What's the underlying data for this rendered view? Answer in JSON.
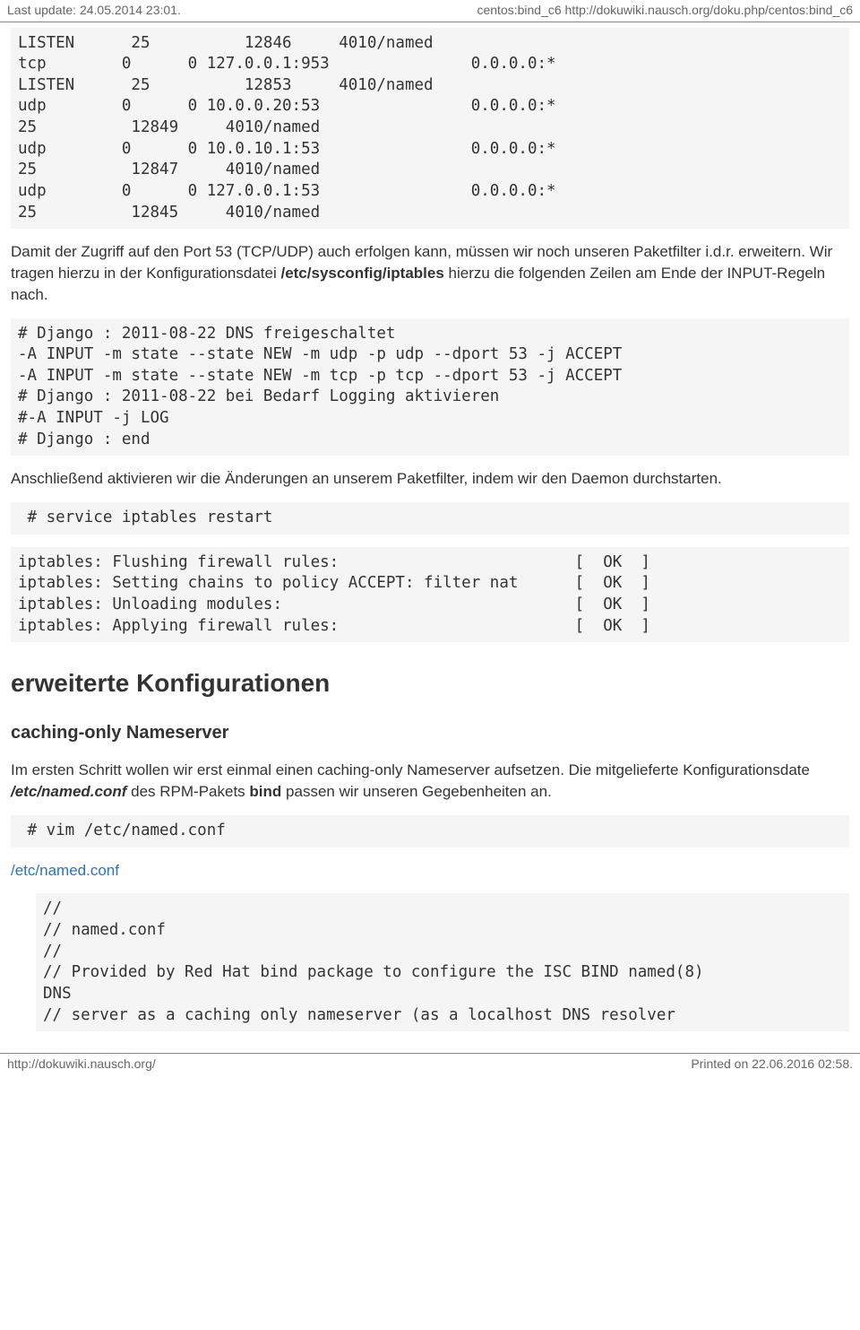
{
  "header": {
    "left": "Last update: 24.05.2014 23:01.",
    "right": "centos:bind_c6 http://dokuwiki.nausch.org/doku.php/centos:bind_c6"
  },
  "footer": {
    "left": "http://dokuwiki.nausch.org/",
    "right": "Printed on 22.06.2016 02:58."
  },
  "block1": "LISTEN      25          12846     4010/named\ntcp        0      0 127.0.0.1:953               0.0.0.0:*\nLISTEN      25          12853     4010/named\nudp        0      0 10.0.0.20:53                0.0.0.0:*\n25          12849     4010/named\nudp        0      0 10.0.10.1:53                0.0.0.0:*\n25          12847     4010/named\nudp        0      0 127.0.0.1:53                0.0.0.0:*\n25          12845     4010/named",
  "para1_a": "Damit der Zugriff auf den Port 53 (TCP/UDP) auch erfolgen kann, müssen wir noch unseren Paketfilter i.d.r. erweitern. Wir tragen hierzu in der Konfigurationsdatei ",
  "para1_b": "/etc/sysconfig/iptables",
  "para1_c": " hierzu die folgenden Zeilen am Ende der INPUT-Regeln nach.",
  "block2": "# Django : 2011-08-22 DNS freigeschaltet\n-A INPUT -m state --state NEW -m udp -p udp --dport 53 -j ACCEPT\n-A INPUT -m state --state NEW -m tcp -p tcp --dport 53 -j ACCEPT\n# Django : 2011-08-22 bei Bedarf Logging aktivieren\n#-A INPUT -j LOG\n# Django : end",
  "para2": "Anschließend aktivieren wir die Änderungen an unserem Paketfilter, indem wir den Daemon durchstarten.",
  "block3": " # service iptables restart",
  "block4": "iptables: Flushing firewall rules:                         [  OK  ]\niptables: Setting chains to policy ACCEPT: filter nat      [  OK  ]\niptables: Unloading modules:                               [  OK  ]\niptables: Applying firewall rules:                         [  OK  ]",
  "heading1": "erweiterte Konfigurationen",
  "heading2": "caching-only Nameserver",
  "para3_a": "Im ersten Schritt wollen wir erst einmal einen caching-only Nameserver aufsetzen. Die mitgelieferte Konfigurationsdate ",
  "para3_b": "/etc/named.conf",
  "para3_c": " des RPM-Pakets ",
  "para3_d": "bind",
  "para3_e": " passen wir unseren Gegebenheiten an.",
  "block5": " # vim /etc/named.conf",
  "link1": "/etc/named.conf",
  "block6": "//\n// named.conf\n//\n// Provided by Red Hat bind package to configure the ISC BIND named(8)\nDNS\n// server as a caching only nameserver (as a localhost DNS resolver"
}
